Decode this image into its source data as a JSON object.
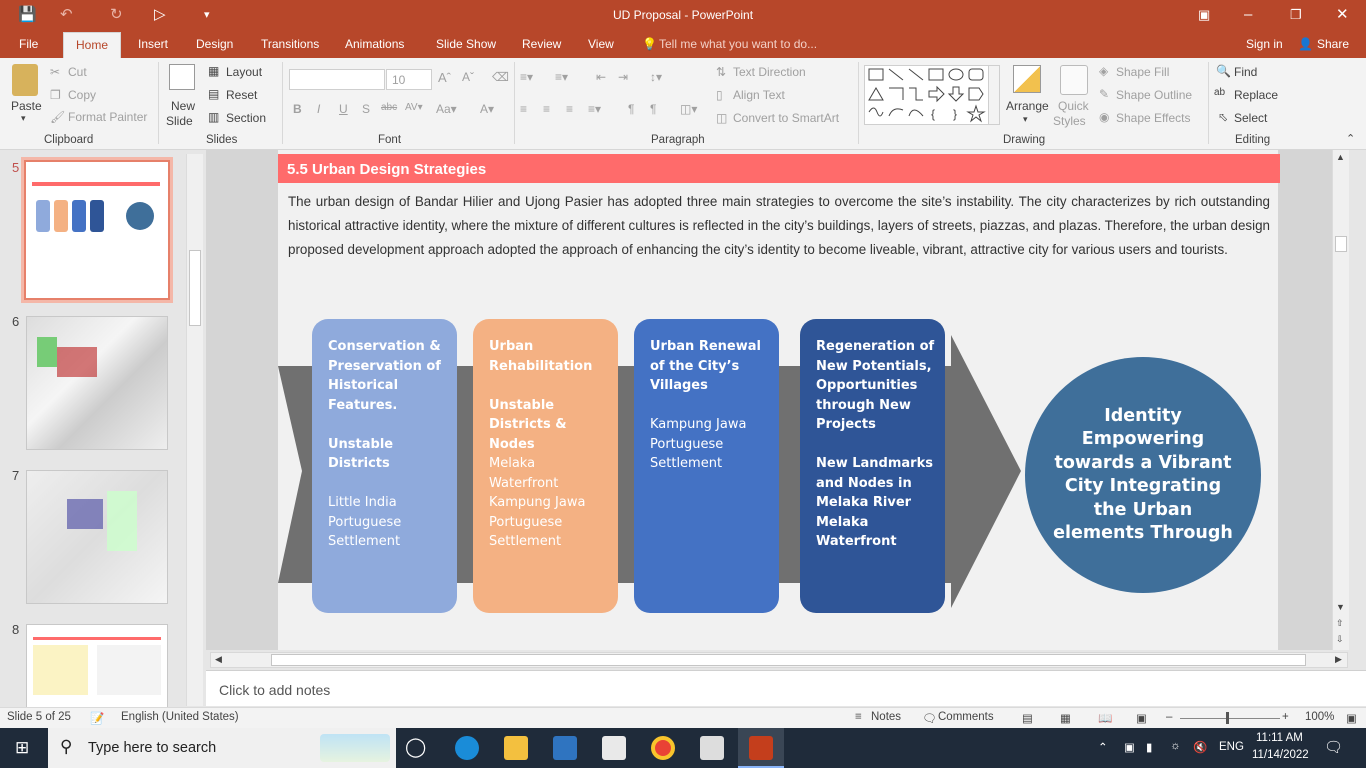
{
  "window": {
    "title": "UD Proposal  -  PowerPoint"
  },
  "tabs": [
    "File",
    "Home",
    "Insert",
    "Design",
    "Transitions",
    "Animations",
    "Slide Show",
    "Review",
    "View"
  ],
  "tell_me": "Tell me what you want to do...",
  "sign_in": "Sign in",
  "share": "Share",
  "ribbon": {
    "clipboard": {
      "paste": "Paste",
      "cut": "Cut",
      "copy": "Copy",
      "format_painter": "Format Painter",
      "label": "Clipboard"
    },
    "slides": {
      "new_slide_1": "New",
      "new_slide_2": "Slide",
      "layout": "Layout",
      "reset": "Reset",
      "section": "Section",
      "label": "Slides"
    },
    "font": {
      "size": "10",
      "label": "Font"
    },
    "paragraph": {
      "text_direction": "Text Direction",
      "align_text": "Align Text",
      "convert_smartart": "Convert to SmartArt",
      "label": "Paragraph"
    },
    "drawing": {
      "arrange": "Arrange",
      "quick_styles_1": "Quick",
      "quick_styles_2": "Styles",
      "shape_fill": "Shape Fill",
      "shape_outline": "Shape Outline",
      "shape_effects": "Shape Effects",
      "label": "Drawing"
    },
    "editing": {
      "find": "Find",
      "replace": "Replace",
      "select": "Select",
      "label": "Editing"
    }
  },
  "thumbnails": [
    {
      "num": "5"
    },
    {
      "num": "6"
    },
    {
      "num": "7"
    },
    {
      "num": "8"
    }
  ],
  "slide": {
    "heading": "5.5  Urban Design Strategies",
    "paragraph": "The urban design of Bandar Hilier and Ujong Pasier has adopted three main strategies to overcome the site’s instability. The city characterizes by rich outstanding historical attractive identity, where the mixture of different cultures is reflected in the city’s buildings, layers of streets, piazzas, and plazas. Therefore, the urban design proposed development approach adopted the approach of enhancing the city’s identity to become liveable, vibrant, attractive city for various users and tourists.",
    "cards": [
      {
        "title": "Conservation & Preservation of Historical Features.",
        "sub": "Unstable Districts",
        "body": "Little India Portuguese Settlement",
        "color": "#8faadc"
      },
      {
        "title": "Urban Rehabilitation",
        "sub": "Unstable Districts & Nodes",
        "body": "Melaka Waterfront Kampung Jawa Portuguese Settlement",
        "color": "#f4b183"
      },
      {
        "title": "Urban Renewal of the City’s Villages",
        "sub": "",
        "body": "Kampung Jawa Portuguese Settlement",
        "color": "#4472c4"
      },
      {
        "title": "Regeneration of New Potentials, Opportunities through New Projects",
        "sub": "New Landmarks and Nodes in Melaka River Melaka Waterfront",
        "body": "",
        "color": "#2f5597"
      }
    ],
    "circle": "Identity Empowering towards a Vibrant City Integrating the Urban elements Through"
  },
  "notes_placeholder": "Click to add notes",
  "status": {
    "slide": "Slide 5 of 25",
    "language": "English (United States)",
    "notes": "Notes",
    "comments": "Comments",
    "zoom": "100%"
  },
  "taskbar": {
    "search": "Type here to search",
    "lang": "ENG",
    "time": "11:11 AM",
    "date": "11/14/2022"
  }
}
